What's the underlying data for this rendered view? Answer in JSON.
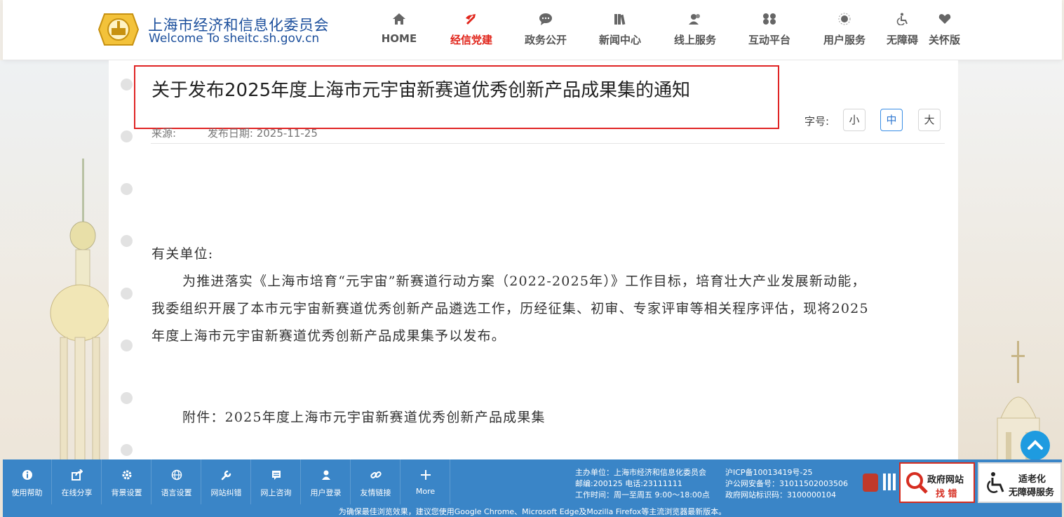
{
  "header": {
    "title": "上海市经济和信息化委员会",
    "subtitle": "Welcome To sheitc.sh.gov.cn",
    "nav": [
      {
        "label": "HOME",
        "icon": "home-icon"
      },
      {
        "label": "经信党建",
        "icon": "party-icon",
        "active": true
      },
      {
        "label": "政务公开",
        "icon": "chat-icon"
      },
      {
        "label": "新闻中心",
        "icon": "books-icon"
      },
      {
        "label": "线上服务",
        "icon": "users-icon"
      },
      {
        "label": "互动平台",
        "icon": "interact-icon"
      },
      {
        "label": "用户服务",
        "icon": "user-service-icon"
      },
      {
        "label": "无障碍",
        "icon": "accessibility-icon"
      },
      {
        "label": "关怀版",
        "icon": "heart-icon"
      }
    ]
  },
  "article": {
    "title": "关于发布2025年度上海市元宇宙新赛道优秀创新产品成果集的通知",
    "source_label": "来源:",
    "date_label": "发布日期:",
    "date": "2025-11-25",
    "greeting": "有关单位:",
    "paragraph_lines": [
      "为推进落实《上海市培育“元宇宙”新赛道行动方案（2022-2025年）》工作目标，培育壮大产业发展新动能，",
      "我委组织开展了本市元宇宙新赛道优秀创新产品遴选工作，历经征集、初审、专家评审等相关程序评估，现将2025",
      "年度上海市元宇宙新赛道优秀创新产品成果集予以发布。"
    ],
    "attachment": "附件：2025年度上海市元宇宙新赛道优秀创新产品成果集"
  },
  "font_size": {
    "label": "字号:",
    "options": [
      "小",
      "中",
      "大"
    ],
    "selected": "中"
  },
  "toolbar": {
    "items": [
      {
        "label": "使用帮助",
        "icon": "info-icon"
      },
      {
        "label": "在线分享",
        "icon": "share-icon"
      },
      {
        "label": "背景设置",
        "icon": "settings-icon"
      },
      {
        "label": "语言设置",
        "icon": "globe-icon"
      },
      {
        "label": "网站纠错",
        "icon": "wrench-icon"
      },
      {
        "label": "网上咨询",
        "icon": "message-icon"
      },
      {
        "label": "用户登录",
        "icon": "user-icon"
      },
      {
        "label": "友情链接",
        "icon": "link-icon"
      },
      {
        "label": "More",
        "icon": "plus-icon"
      }
    ]
  },
  "footer": {
    "sponsor": "主办单位：上海市经济和信息化委员会",
    "postal": "邮编:200125 电话:23111111",
    "hours": "工作时间：周一至周五 9:00～18:00点",
    "icp": "沪ICP备10013419号-25",
    "police": "沪公网安备号：31011502003506",
    "gov_code": "政府网站标识码：3100000104",
    "gov_badge_top": "政府网站",
    "gov_badge_bottom": "找 错",
    "acc_badge_top": "适老化",
    "acc_badge_bottom": "无障碍服务",
    "note": "为确保最佳浏览效果，建议您使用Google Chrome、Microsoft Edge及Mozilla Firefox等主流浏览器最新版本。"
  },
  "colors": {
    "brand_blue": "#1c4f9c",
    "active_red": "#e1251b",
    "toolbar_blue": "#3a85c7",
    "highlight_box": "#e02424"
  }
}
